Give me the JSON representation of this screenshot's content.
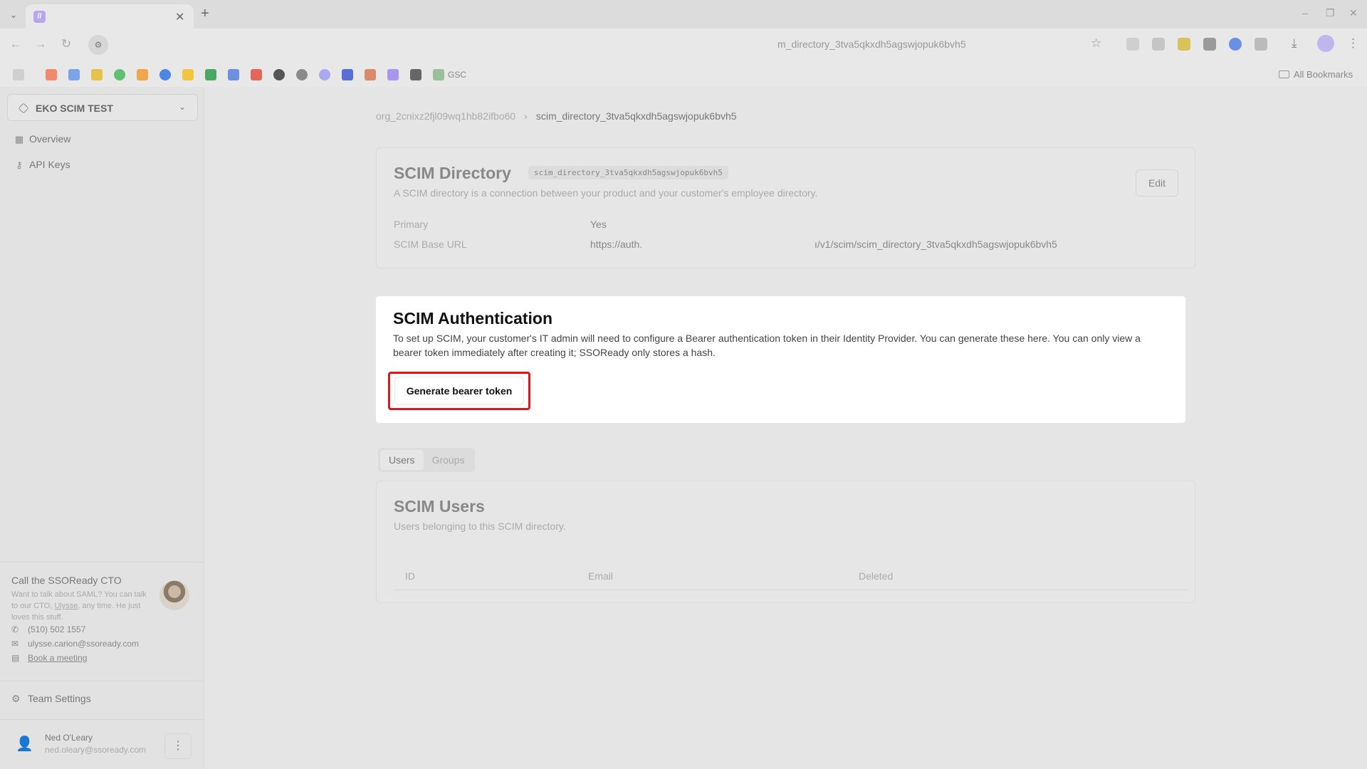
{
  "browser": {
    "tab_close": "✕",
    "new_tab": "+",
    "url": "m_directory_3tva5qkxdh5agswjopuk6bvh5",
    "bookmark_text": "GSC",
    "all_bookmarks": "All Bookmarks",
    "window_controls": [
      "–",
      "❐",
      "✕"
    ]
  },
  "sidebar": {
    "org_name": "EKO SCIM TEST",
    "nav": [
      {
        "label": "Overview",
        "icon": "grid-icon"
      },
      {
        "label": "API Keys",
        "icon": "key-icon"
      }
    ],
    "cto": {
      "title": "Call the SSOReady CTO",
      "desc_pre": "Want to talk about SAML? You can talk to our CTO, ",
      "desc_link": "Ulysse",
      "desc_post": ", any time. He just loves this stuff.",
      "phone": "(510) 502 1557",
      "email": "ulysse.carion@ssoready.com",
      "meeting": "Book a meeting"
    },
    "team_settings": "Team Settings",
    "user": {
      "name": "Ned O'Leary",
      "email": "ned.oleary@ssoready.com"
    }
  },
  "breadcrumb": {
    "org": "org_2cnixz2fjl09wq1hb82ifbo60",
    "current": "scim_directory_3tva5qkxdh5agswjopuk6bvh5"
  },
  "directory": {
    "title": "SCIM Directory",
    "id_badge": "scim_directory_3tva5qkxdh5agswjopuk6bvh5",
    "subtitle": "A SCIM directory is a connection between your product and your customer's employee directory.",
    "edit_label": "Edit",
    "primary_label": "Primary",
    "primary_value": "Yes",
    "base_url_label": "SCIM Base URL",
    "base_url_start": "https://auth.",
    "base_url_end": "ı/v1/scim/scim_directory_3tva5qkxdh5agswjopuk6bvh5"
  },
  "auth": {
    "title": "SCIM Authentication",
    "description": "To set up SCIM, your customer's IT admin will need to configure a Bearer authentication token in their Identity Provider. You can generate these here. You can only view a bearer token immediately after creating it; SSOReady only stores a hash.",
    "button": "Generate bearer token"
  },
  "tabs": [
    "Users",
    "Groups"
  ],
  "users": {
    "title": "SCIM Users",
    "subtitle": "Users belonging to this SCIM directory.",
    "columns": [
      "ID",
      "Email",
      "Deleted"
    ]
  }
}
